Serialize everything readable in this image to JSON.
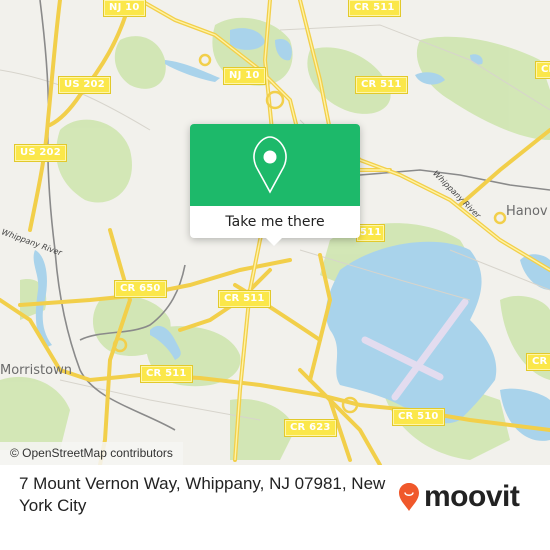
{
  "map": {
    "road_shields": [
      {
        "id": "nj10-top",
        "label": "NJ 10"
      },
      {
        "id": "nj10-mid",
        "label": "NJ 10"
      },
      {
        "id": "us202-top",
        "label": "US 202"
      },
      {
        "id": "us202-left",
        "label": "US 202"
      },
      {
        "id": "cr511-top",
        "label": "CR 511"
      },
      {
        "id": "cr511-upper",
        "label": "CR 511"
      },
      {
        "id": "cr511-right",
        "label": "CR"
      },
      {
        "id": "cr511-partial",
        "label": "511"
      },
      {
        "id": "cr650",
        "label": "CR 650"
      },
      {
        "id": "cr511-center",
        "label": "CR 511"
      },
      {
        "id": "cr511-lower",
        "label": "CR 511"
      },
      {
        "id": "cr623",
        "label": "CR 623"
      },
      {
        "id": "cr510",
        "label": "CR 510"
      },
      {
        "id": "cr-right-lower",
        "label": "CR"
      }
    ],
    "places": {
      "morristown": "Morristown",
      "hanover": "Hanov"
    },
    "rivers": {
      "whippany_left": "Whippany River",
      "whippany_right": "Whippany River"
    },
    "attribution": "© OpenStreetMap contributors"
  },
  "popup": {
    "icon": "map-pin-icon",
    "button_label": "Take me there",
    "color": "#1db96a"
  },
  "footer": {
    "address": "7 Mount Vernon Way, Whippany, NJ 07981, New York City",
    "brand": "moovit",
    "brand_color": "#f0582b"
  }
}
